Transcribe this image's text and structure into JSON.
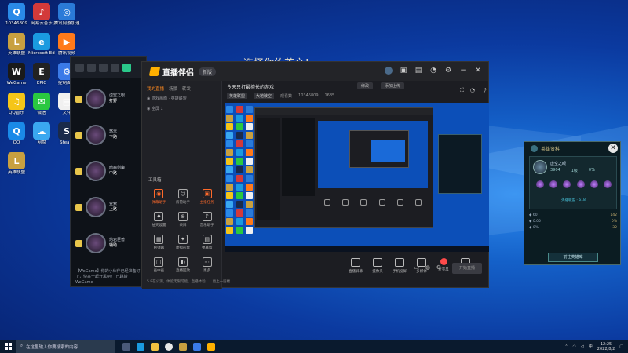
{
  "desktop": {
    "icons": [
      {
        "label": "10346809",
        "color": "#2a8ae8",
        "glyph": "Q"
      },
      {
        "label": "网易云音乐",
        "color": "#d33a3a",
        "glyph": "♪"
      },
      {
        "label": "腾讯网游加速",
        "color": "#2a7ad8",
        "glyph": "◎"
      },
      {
        "label": "英雄联盟",
        "color": "#c8a040",
        "glyph": "L"
      },
      {
        "label": "Microsoft Edge",
        "color": "#1a9ae0",
        "glyph": "e"
      },
      {
        "label": "腾讯视频",
        "color": "#ff7a1a",
        "glyph": "▶"
      },
      {
        "label": "WeGame",
        "color": "#1a1a1a",
        "glyph": "W"
      },
      {
        "label": "EPIC",
        "color": "#222",
        "glyph": "E"
      },
      {
        "label": "控制面板",
        "color": "#3a7ae8",
        "glyph": "⚙"
      },
      {
        "label": "QQ音乐",
        "color": "#f5c518",
        "glyph": "♫"
      },
      {
        "label": "微信",
        "color": "#2ac840",
        "glyph": "✉"
      },
      {
        "label": "文件",
        "color": "#f0f0f0",
        "glyph": "▤"
      },
      {
        "label": "QQ",
        "color": "#1a8ae8",
        "glyph": "Q"
      },
      {
        "label": "网盘",
        "color": "#3aa8f0",
        "glyph": "☁"
      },
      {
        "label": "Steam",
        "color": "#1a2a4a",
        "glyph": "S"
      },
      {
        "label": "英雄联盟",
        "color": "#c8a040",
        "glyph": "L"
      }
    ],
    "top_label": "选择你的英文！"
  },
  "game_window": {
    "rows": [
      {
        "name": "虚空之眼",
        "sub": "打野"
      },
      {
        "name": "悠米",
        "sub": "下路"
      },
      {
        "name": "暗裔剑魔",
        "sub": "中路"
      },
      {
        "name": "亚索",
        "sub": "上路"
      },
      {
        "name": "熔岩巨兽",
        "sub": "辅助"
      }
    ],
    "chat": "【WeGame】你的小伙伴已经准备好了，快来一起开黑吧！ 已跳转 WeGame"
  },
  "live_app": {
    "logo": "直播伴侣",
    "version": "新版",
    "tabs": [
      "我的直播",
      "场景",
      "转发"
    ],
    "scene_items": [
      "游戏画面 · 英雄联盟",
      "全屏 1"
    ],
    "tools_label": "工具箱",
    "tools": [
      {
        "label": "弹幕助手",
        "glyph": "◉",
        "orange": true
      },
      {
        "label": "房管助手",
        "glyph": "☺",
        "orange": false
      },
      {
        "label": "主播任务",
        "glyph": "▣",
        "orange": true
      },
      {
        "label": "抽奖设置",
        "glyph": "♦",
        "orange": false
      },
      {
        "label": "录屏",
        "glyph": "⊕",
        "orange": false
      },
      {
        "label": "音乐助手",
        "glyph": "♪",
        "orange": false
      },
      {
        "label": "贴弹幕",
        "glyph": "▦",
        "orange": false
      },
      {
        "label": "虚拟形象",
        "glyph": "✦",
        "orange": false
      },
      {
        "label": "弹幕墙",
        "glyph": "▤",
        "orange": false
      },
      {
        "label": "画中画",
        "glyph": "▢",
        "orange": false
      },
      {
        "label": "直播回放",
        "glyph": "◐",
        "orange": false
      },
      {
        "label": "更多",
        "glyph": "⋯",
        "orange": false
      }
    ],
    "footer": "5.8在公测，体验无限可能，直播体验……更上一层楼",
    "stream_title": "今天只打最擅长的游戏",
    "btn_edit": "修改",
    "btn_upload": "添加上传",
    "meta": {
      "category": "英雄联盟",
      "game": "大地破空",
      "viewers_label": "观看数",
      "viewers": "10346809",
      "likes": "1685"
    },
    "bottom_tools": [
      {
        "label": "直播屏幕",
        "red": false
      },
      {
        "label": "摄像头",
        "red": false
      },
      {
        "label": "手机投屏",
        "red": false
      },
      {
        "label": "多媒体",
        "red": false
      },
      {
        "label": "麦克风",
        "red": true
      },
      {
        "label": "扬声器",
        "red": false
      }
    ],
    "start_button": "开始直播"
  },
  "lol_panel": {
    "title": "英雄资料",
    "player_name": "虚空之眼",
    "stats": [
      "3904",
      "1级",
      "0%"
    ],
    "sub": "英雄联盟 · 618",
    "rows": [
      {
        "k": "60",
        "v": "142"
      },
      {
        "k": "0.05",
        "v": "0%"
      },
      {
        "k": "0%",
        "v": "32"
      }
    ],
    "button": "前往英雄库"
  },
  "taskbar": {
    "search_placeholder": "在这里输入你要搜索的内容",
    "time": "12:25",
    "date": "2022/8/2",
    "lang": "中"
  }
}
